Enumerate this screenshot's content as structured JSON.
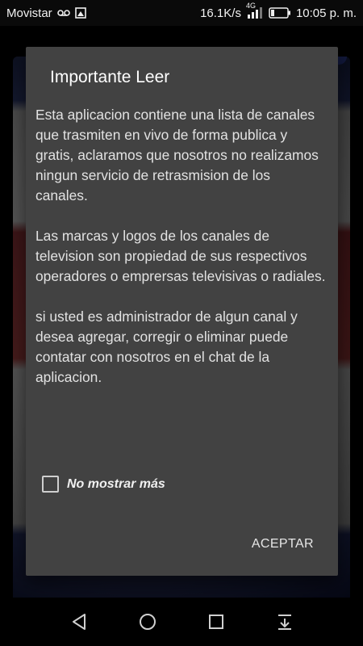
{
  "status_bar": {
    "carrier": "Movistar",
    "net_speed": "16.1K/s",
    "net_type": "4G",
    "time": "10:05 p. m."
  },
  "dialog": {
    "title": "Importante Leer",
    "message": "Esta aplicacion contiene una lista de canales que trasmiten en vivo de forma publica y gratis, aclaramos que nosotros no realizamos ningun servicio de retrasmision de los canales.\n\nLas marcas y logos de los canales de television son propiedad de sus respectivos operadores o emprersas televisivas o radiales.\n\nsi usted es administrador de algun canal y desea agregar, corregir o eliminar puede contatar con nosotros en el chat de la aplicacion.",
    "checkbox_label": "No mostrar más",
    "checkbox_checked": false,
    "accept_label": "ACEPTAR"
  },
  "colors": {
    "dialog_bg": "#424242",
    "statusbar_bg": "#0a0a0a"
  },
  "icons": {
    "status_left": [
      "voicemail-icon",
      "image-icon"
    ],
    "status_right": [
      "signal-icon",
      "battery-icon"
    ],
    "nav": [
      "back-icon",
      "home-icon",
      "recents-icon",
      "notification-pull-icon"
    ]
  }
}
